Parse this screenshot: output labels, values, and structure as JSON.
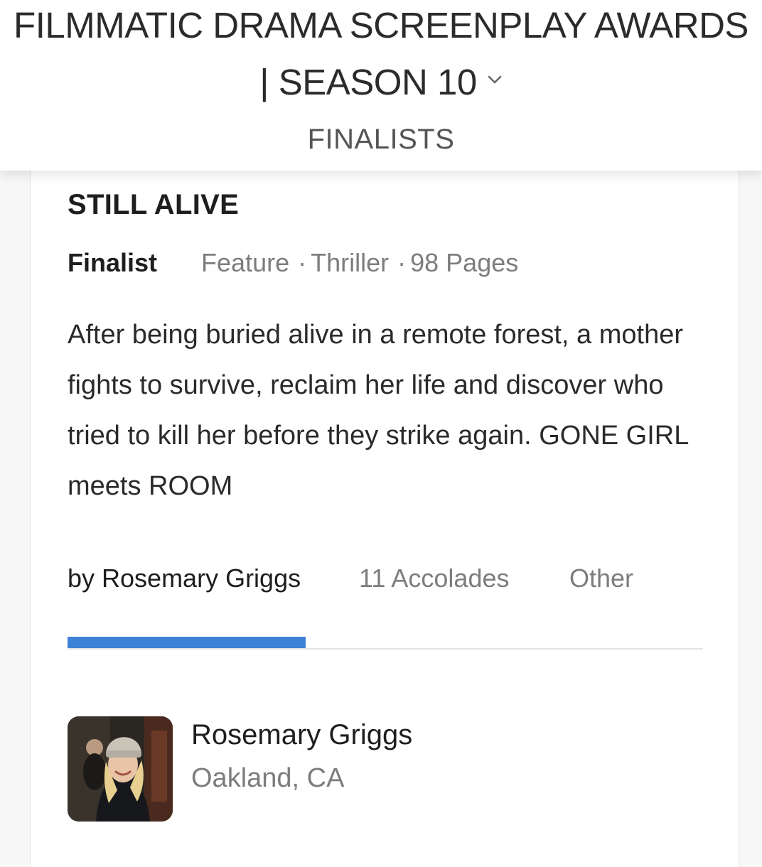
{
  "header": {
    "title_line1": "FILMMATIC DRAMA SCREENPLAY AWARDS",
    "title_line2": "| SEASON 10",
    "dropdown_icon": "chevron-down-icon",
    "section_label": "FINALISTS"
  },
  "entry": {
    "title": "STILL ALIVE",
    "status": "Finalist",
    "format": "Feature",
    "genre": "Thriller",
    "pages": "98 Pages",
    "separator": "·",
    "logline": "After being buried alive in a remote forest, a mother fights to survive, reclaim her life and discover who tried to kill her before they strike again. GONE GIRL meets ROOM"
  },
  "tabs": [
    {
      "label": "by Rosemary Griggs",
      "active": true
    },
    {
      "label": "11 Accolades",
      "active": false
    },
    {
      "label": "Other",
      "active": false
    }
  ],
  "writer": {
    "name": "Rosemary Griggs",
    "location": "Oakland, CA",
    "avatar_icon": "writer-photo"
  },
  "colors": {
    "accent": "#3d82d6",
    "text_primary": "#1e1e1e",
    "text_secondary": "#7d7d7d",
    "background": "#f7f7f7",
    "card": "#ffffff"
  }
}
